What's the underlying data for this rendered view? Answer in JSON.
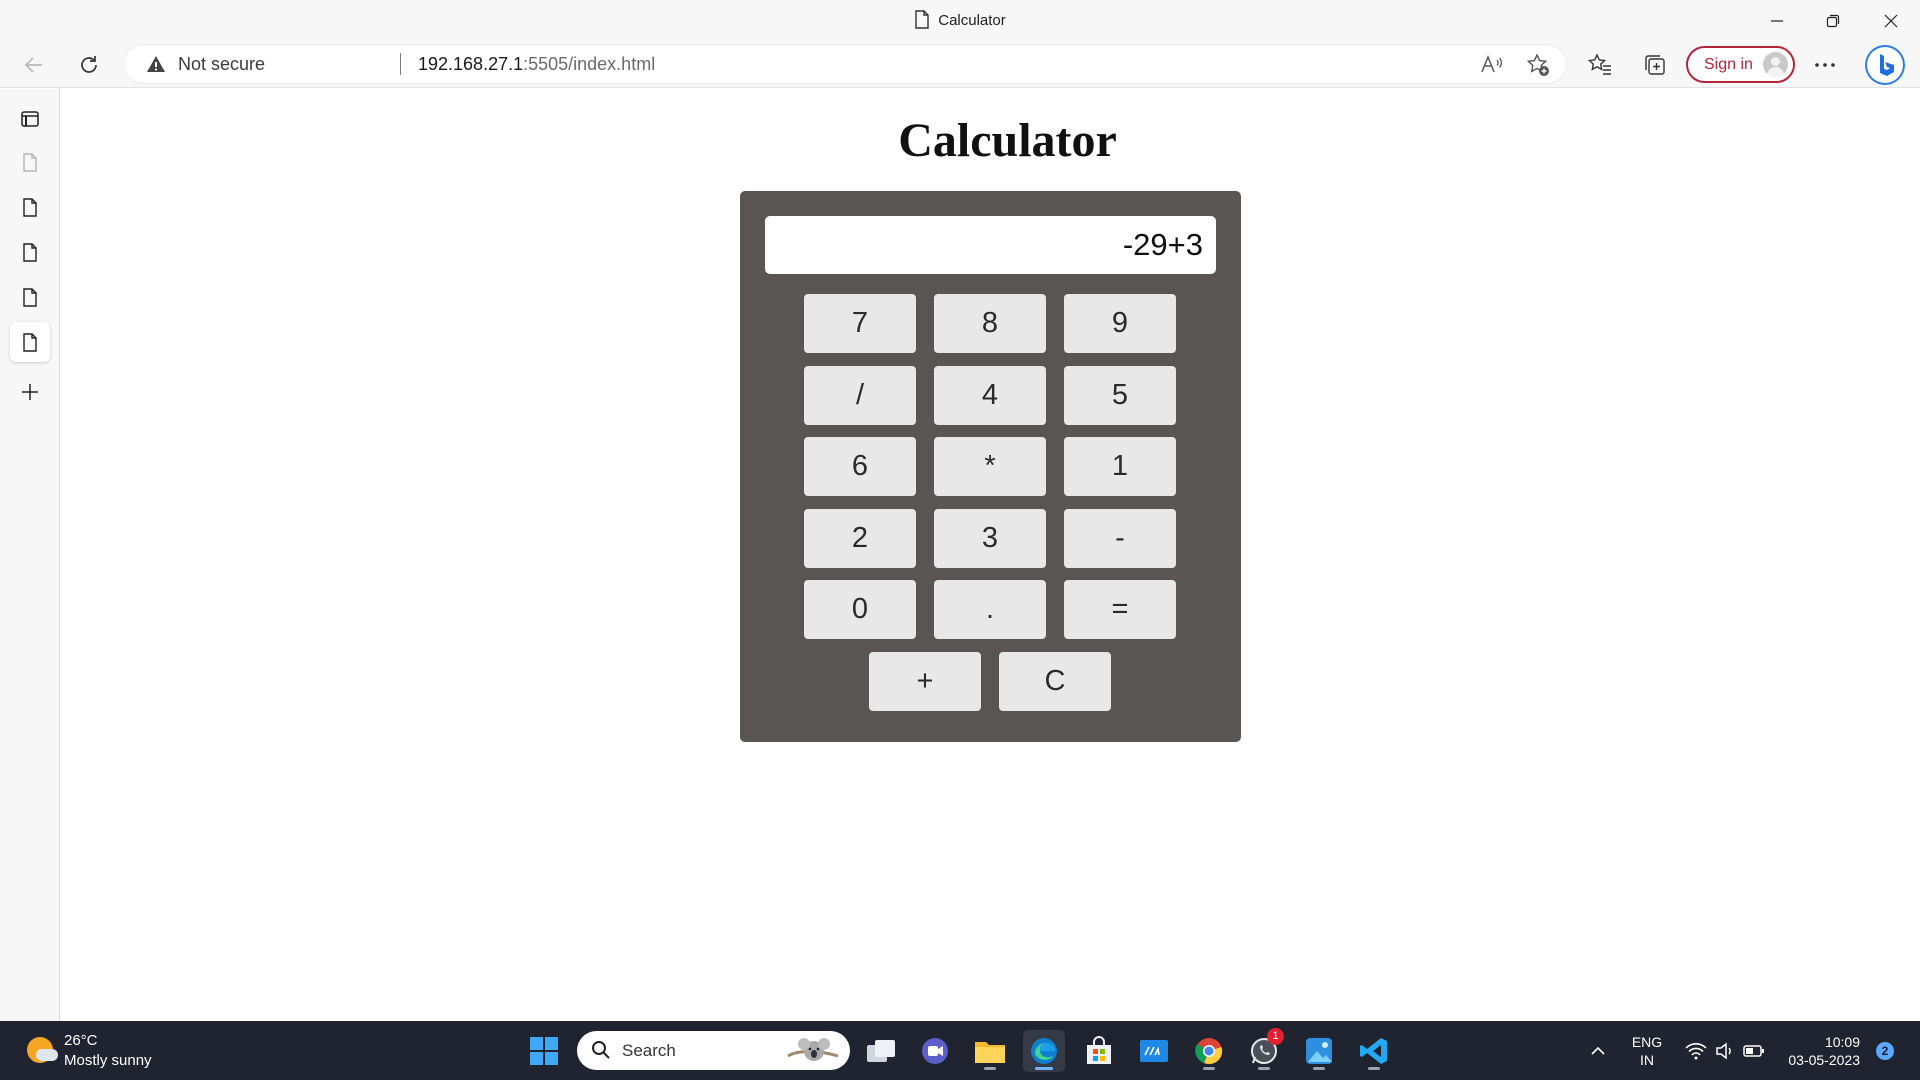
{
  "window": {
    "title": "Calculator"
  },
  "address_bar": {
    "security_label": "Not secure",
    "url_host": "192.168.27.1",
    "url_rest": ":5505/index.html",
    "sign_in_label": "Sign in"
  },
  "page": {
    "heading": "Calculator",
    "display_value": "-29+3",
    "keys": [
      [
        "7",
        "8",
        "9"
      ],
      [
        "/",
        "4",
        "5"
      ],
      [
        "6",
        "*",
        "1"
      ],
      [
        "2",
        "3",
        "-"
      ],
      [
        "0",
        ".",
        "="
      ],
      [
        "+",
        "C"
      ]
    ]
  },
  "taskbar": {
    "weather_temp": "26°C",
    "weather_condition": "Mostly sunny",
    "search_label": "Search",
    "whatsapp_badge": "1",
    "language_line1": "ENG",
    "language_line2": "IN",
    "time": "10:09",
    "date": "03-05-2023",
    "notification_count": "2"
  },
  "colors": {
    "calculator_body": "#595555",
    "key_background": "#e8e8e8",
    "sign_in_accent": "#b3263a",
    "taskbar_background": "#1f2430"
  }
}
